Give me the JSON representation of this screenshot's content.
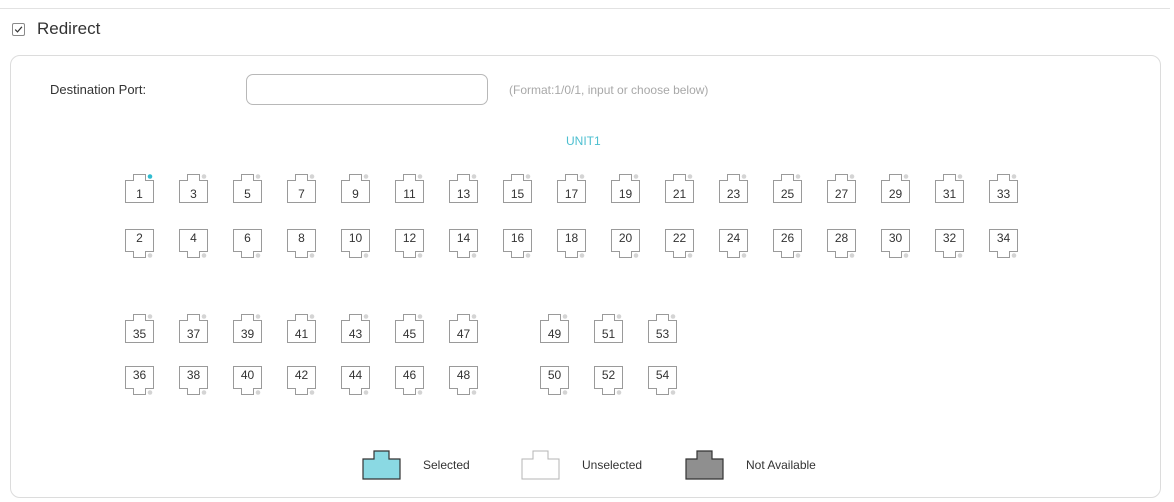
{
  "redirect": {
    "label": "Redirect",
    "checked": true
  },
  "destination": {
    "label": "Destination Port:",
    "value": "",
    "hint": "(Format:1/0/1, input or choose below)"
  },
  "unit": {
    "title": "UNIT1"
  },
  "ports": {
    "group1_top": [
      "1",
      "3",
      "5",
      "7",
      "9",
      "11",
      "13",
      "15",
      "17",
      "19",
      "21",
      "23",
      "25",
      "27",
      "29",
      "31",
      "33"
    ],
    "group1_bottom": [
      "2",
      "4",
      "6",
      "8",
      "10",
      "12",
      "14",
      "16",
      "18",
      "20",
      "22",
      "24",
      "26",
      "28",
      "30",
      "32",
      "34"
    ],
    "group2_top": [
      "35",
      "37",
      "39",
      "41",
      "43",
      "45",
      "47"
    ],
    "group2_bottom": [
      "36",
      "38",
      "40",
      "42",
      "44",
      "46",
      "48"
    ],
    "group3_top": [
      "49",
      "51",
      "53"
    ],
    "group3_bottom": [
      "50",
      "52",
      "54"
    ],
    "active_link_ports": [
      "1"
    ]
  },
  "legend": {
    "selected": "Selected",
    "unselected": "Unselected",
    "not_available": "Not Available"
  },
  "colors": {
    "selected_fill": "#8ad9e3",
    "not_available_fill": "#8f8f8f",
    "port_border": "#9a9a9a",
    "link_dot_active": "#31bcd0",
    "link_dot_idle": "#d4d4d4",
    "hint_text": "#a8a8a8",
    "unit_title": "#4dbfd0"
  }
}
